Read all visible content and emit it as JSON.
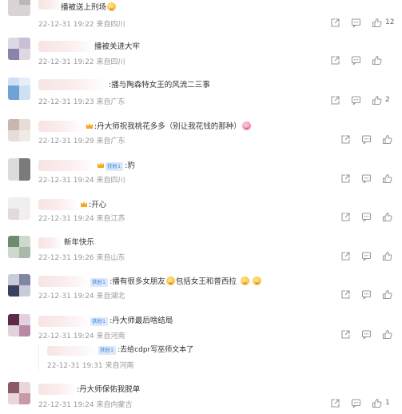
{
  "comments": [
    {
      "text": "播被送上刑场",
      "date": "22-12-31 19:22",
      "source": "来自四川",
      "likes": "12"
    },
    {
      "text": "播被关进大牢",
      "date": "22-12-31 19:22",
      "source": "来自四川",
      "likes": ""
    },
    {
      "text": ":播与陶森特女王的风流二三事",
      "date": "22-12-31 19:23",
      "source": "来自广东",
      "likes": "2"
    },
    {
      "text": ":丹大师祝我桃花多多（别让我花钱的那种）",
      "date": "22-12-31 19:29",
      "source": "来自广东",
      "likes": ""
    },
    {
      "text": ":豹",
      "date": "22-12-31 19:24",
      "source": "来自四川",
      "likes": ""
    },
    {
      "text": ":开心",
      "date": "22-12-31 19:24",
      "source": "来自江苏",
      "likes": ""
    },
    {
      "text": "新年快乐",
      "date": "22-12-31 19:26",
      "source": "来自山东",
      "likes": ""
    },
    {
      "text": ":播有很多女朋友",
      "text2": "包括女王和普西拉",
      "date": "22-12-31 19:24",
      "source": "来自湖北",
      "likes": ""
    },
    {
      "text": ":丹大师最后啥结局",
      "date": "22-12-31 19:24",
      "source": "来自河南",
      "likes": ""
    },
    {
      "text": ":丹大师保佑我脱单",
      "date": "22-12-31 19:24",
      "source": "来自内蒙古",
      "likes": "1"
    }
  ],
  "reply": {
    "text": ":去给cdpr写巫师文本了",
    "date": "22-12-31 19:31",
    "source": "来自河南"
  },
  "badge_label": "铁粉1",
  "colors": {
    "meta": "#999999",
    "text": "#333333",
    "badge_bg": "#dbe9fb",
    "badge_fg": "#4a8ae0"
  },
  "icons": [
    "share-icon",
    "comment-icon",
    "like-icon",
    "crown-icon",
    "emoji-icon"
  ]
}
